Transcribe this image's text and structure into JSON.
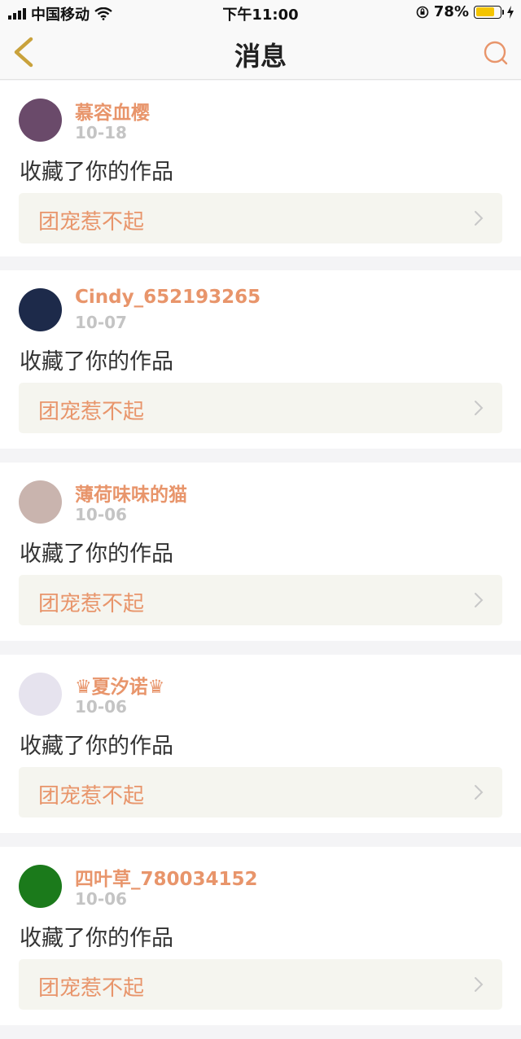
{
  "status": {
    "carrier": "中国移动",
    "time": "下午11:00",
    "battery": "78%",
    "battery_level": 0.78
  },
  "nav": {
    "title": "消息",
    "back_icon": "chevron-left-icon",
    "search_icon": "search-icon"
  },
  "messages": [
    {
      "username": "慕容血樱",
      "date": "10-18",
      "text": "收藏了你的作品",
      "work": "团宠惹不起",
      "avatar_color": "#6a4a6a"
    },
    {
      "username": "Cindy_652193265",
      "date": "10-07",
      "text": "收藏了你的作品",
      "work": "团宠惹不起",
      "avatar_color": "#1d2a4a"
    },
    {
      "username": "薄荷味味的猫",
      "date": "10-06",
      "text": "收藏了你的作品",
      "work": "团宠惹不起",
      "avatar_color": "#c9b4ae"
    },
    {
      "username": "♛夏汐诺♛",
      "date": "10-06",
      "text": "收藏了你的作品",
      "work": "团宠惹不起",
      "avatar_color": "#e6e3ee"
    },
    {
      "username": "四叶草_780034152",
      "date": "10-06",
      "text": "收藏了你的作品",
      "work": "团宠惹不起",
      "avatar_color": "#1b7a1b"
    }
  ],
  "colors": {
    "accent": "#e8956b",
    "back_icon": "#c9a23c"
  }
}
